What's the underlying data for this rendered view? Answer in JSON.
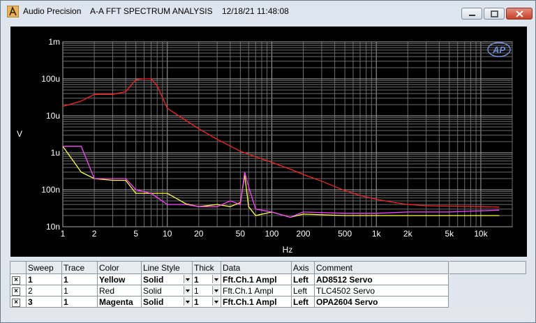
{
  "window": {
    "app_name": "Audio Precision",
    "title_text": "Audio Precision    A-A FFT SPECTRUM ANALYSIS    12/18/21 11:48:08",
    "icons": [
      "app-icon",
      "minimize-icon",
      "maximize-icon",
      "close-icon"
    ]
  },
  "chart_data": {
    "type": "line",
    "xlabel": "Hz",
    "ylabel": "V",
    "xscale": "log",
    "yscale": "log",
    "xlim": [
      1,
      20000
    ],
    "ylim": [
      1e-08,
      0.001
    ],
    "x_ticks": [
      "1",
      "2",
      "5",
      "10",
      "20",
      "50",
      "100",
      "200",
      "500",
      "1k",
      "2k",
      "5k",
      "10k"
    ],
    "y_ticks": [
      "1m",
      "100u",
      "10u",
      "1u",
      "100n",
      "10n"
    ],
    "grid": true,
    "background": "#000000",
    "series": [
      {
        "color": "#ff2020",
        "x": [
          1,
          1.5,
          2,
          3,
          4,
          5,
          6,
          7,
          8,
          10,
          15,
          20,
          30,
          50,
          70,
          100,
          150,
          200,
          300,
          500,
          700,
          1000,
          1500,
          2000,
          3000,
          5000,
          10000,
          15000
        ],
        "y": [
          1.8e-05,
          2.5e-05,
          3.8e-05,
          3.8e-05,
          4.5e-05,
          9.5e-05,
          0.0001,
          0.0001,
          6.5e-05,
          1.6e-05,
          7.5e-06,
          4.5e-06,
          2.3e-06,
          1.1e-06,
          7.8e-07,
          5.5e-07,
          3.6e-07,
          2.6e-07,
          1.7e-07,
          9.5e-08,
          7e-08,
          5.5e-08,
          4.5e-08,
          4e-08,
          3.7e-08,
          3.6e-08,
          3.5e-08,
          3.4e-08
        ]
      },
      {
        "color": "#ffff40",
        "x": [
          1,
          1.5,
          2,
          3,
          4,
          5,
          7,
          10,
          15,
          20,
          30,
          40,
          50,
          55,
          60,
          70,
          100,
          150,
          200,
          500,
          1000,
          2000,
          5000,
          10000,
          15000
        ],
        "y": [
          1.5e-06,
          3e-07,
          2e-07,
          1.8e-07,
          1.8e-07,
          8e-08,
          8e-08,
          8e-08,
          4.2e-08,
          3.5e-08,
          4e-08,
          3.5e-08,
          4.5e-08,
          2.5e-07,
          3.5e-08,
          2e-08,
          2.5e-08,
          1.8e-08,
          2.2e-08,
          2e-08,
          2e-08,
          2e-08,
          2e-08,
          2e-08,
          2e-08
        ]
      },
      {
        "color": "#ff40ff",
        "x": [
          1,
          1.5,
          2,
          3,
          4,
          5,
          7,
          10,
          15,
          20,
          30,
          40,
          50,
          55,
          60,
          70,
          100,
          150,
          200,
          500,
          1000,
          2000,
          5000,
          10000,
          15000
        ],
        "y": [
          1.5e-06,
          1.5e-06,
          2e-07,
          2e-07,
          2e-07,
          1e-07,
          8e-08,
          4e-08,
          4e-08,
          3.5e-08,
          3.5e-08,
          5e-08,
          4e-08,
          3e-07,
          1.2e-07,
          3e-08,
          2.5e-08,
          1.8e-08,
          2.5e-08,
          2.3e-08,
          2.3e-08,
          2.5e-08,
          2.5e-08,
          2.7e-08,
          2.8e-08
        ]
      }
    ]
  },
  "logo_text": "AP",
  "table": {
    "headers": [
      "Sweep",
      "Trace",
      "Color",
      "Line Style",
      "Thick",
      "Data",
      "Axis",
      "Comment"
    ],
    "rows": [
      {
        "checked": "×",
        "sweep": "1",
        "trace": "1",
        "color": "Yellow",
        "style": "Solid",
        "thick": "1",
        "data": "Fft.Ch.1 Ampl",
        "axis": "Left",
        "comment": "AD8512 Servo"
      },
      {
        "checked": "×",
        "sweep": "2",
        "trace": "1",
        "color": "Red",
        "style": "Solid",
        "thick": "1",
        "data": "Fft.Ch.1 Ampl",
        "axis": "Left",
        "comment": "TLC4502 Servo"
      },
      {
        "checked": "×",
        "sweep": "3",
        "trace": "1",
        "color": "Magenta",
        "style": "Solid",
        "thick": "1",
        "data": "Fft.Ch.1 Ampl",
        "axis": "Left",
        "comment": "OPA2604 Servo"
      }
    ]
  }
}
